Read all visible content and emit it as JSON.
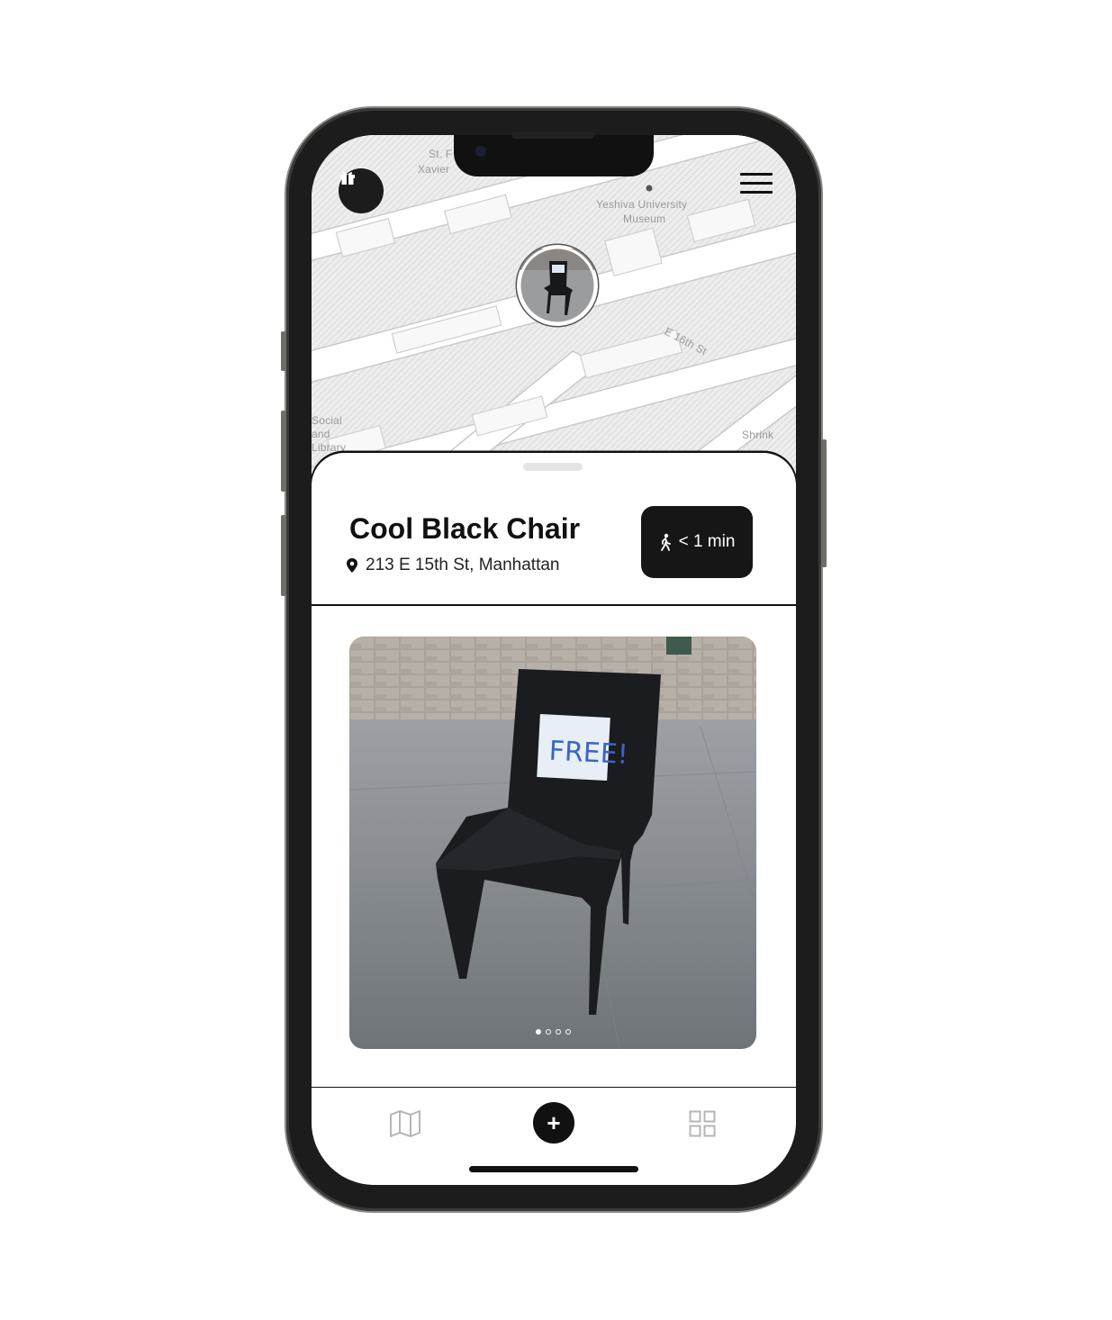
{
  "map": {
    "labels": [
      "St. F",
      "Xavier",
      "Yeshiva University",
      "Museum",
      "E 16th St",
      "Social",
      "and",
      "Library",
      "Shrink"
    ],
    "pin": {
      "icon": "chair-photo-icon"
    }
  },
  "header": {
    "gift_icon": "gift-icon",
    "menu_icon": "hamburger-menu-icon"
  },
  "listing": {
    "title": "Cool Black Chair",
    "address": "213 E 15th St, Manhattan",
    "walk_time": "< 1 min",
    "walk_icon": "walking-person-icon",
    "photo_sign_text": "FREE!",
    "photo_count": 4,
    "photo_index": 1
  },
  "tabbar": {
    "items": [
      {
        "name": "map",
        "icon": "map-icon"
      },
      {
        "name": "add",
        "label": "+",
        "icon": "plus-icon"
      },
      {
        "name": "grid",
        "icon": "grid-icon"
      }
    ]
  }
}
